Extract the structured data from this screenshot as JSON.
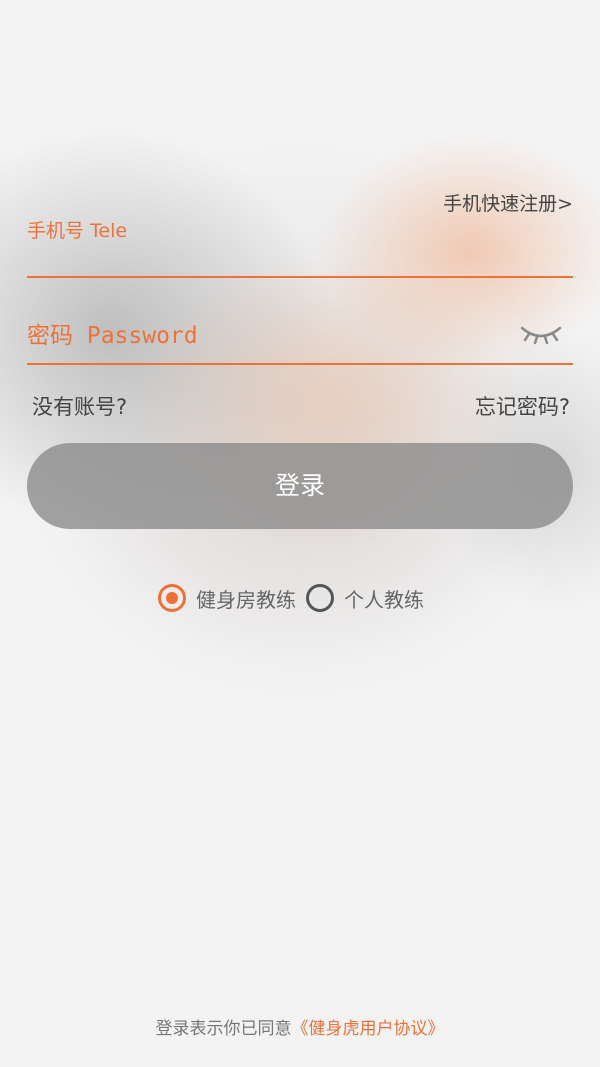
{
  "register_link": "手机快速注册>",
  "phone": {
    "placeholder": "手机号 Tele"
  },
  "password": {
    "placeholder": "密码 Password",
    "toggle_icon": "eye-closed-icon"
  },
  "links": {
    "no_account": "没有账号?",
    "forgot_password": "忘记密码?"
  },
  "login_button": "登录",
  "roles": [
    {
      "label": "健身房教练",
      "selected": true
    },
    {
      "label": "个人教练",
      "selected": false
    }
  ],
  "agreement": {
    "prefix": "登录表示你已同意",
    "link": "《健身虎用户协议》"
  },
  "colors": {
    "accent": "#ee7138",
    "button": "#8c8c8c",
    "background": "#f3f3f3"
  }
}
